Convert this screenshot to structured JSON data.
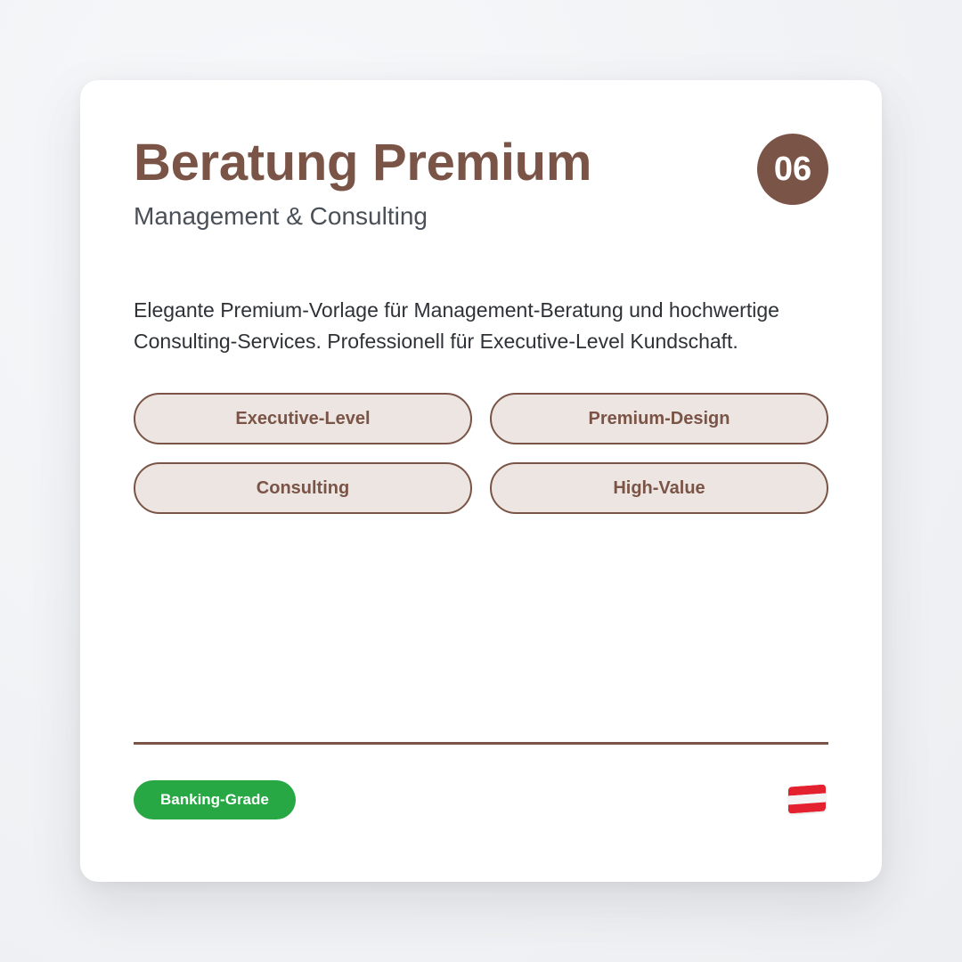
{
  "card": {
    "title": "Beratung Premium",
    "subtitle": "Management & Consulting",
    "number": "06",
    "description": "Elegante Premium-Vorlage für Management-Beratung und hochwertige Consulting-Services. Professionell für Executive-Level Kundschaft.",
    "tags": [
      {
        "label": "Executive-Level"
      },
      {
        "label": "Premium-Design"
      },
      {
        "label": "Consulting"
      },
      {
        "label": "High-Value"
      }
    ],
    "footer": {
      "badge_label": "Banking-Grade",
      "flag_icon": "austria-flag-icon"
    }
  },
  "colors": {
    "accent": "#7a5446",
    "tag_background": "#ece5e2",
    "badge_green": "#28a745",
    "subtitle_text": "#4a5058",
    "body_text": "#2e3237",
    "flag_red": "#e4212e",
    "flag_white": "#f4f4f4"
  }
}
